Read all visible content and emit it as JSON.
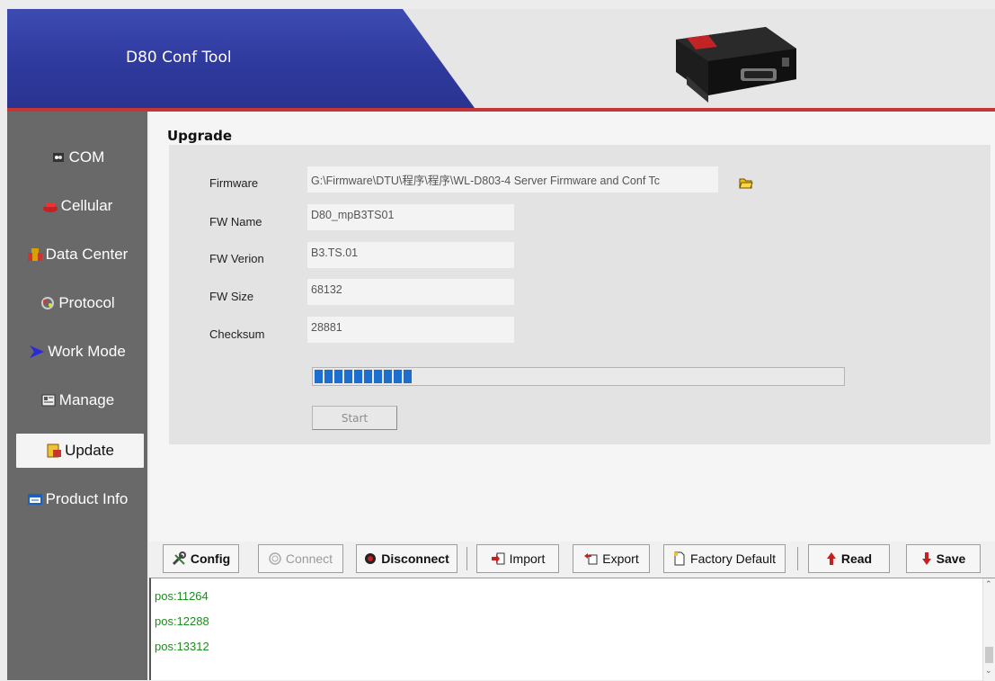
{
  "header": {
    "title": "D80 Conf Tool",
    "device_image": "d80-device-photo"
  },
  "sidebar": {
    "items": [
      {
        "label": "COM",
        "icon": "com-port-icon"
      },
      {
        "label": "Cellular",
        "icon": "phone-icon"
      },
      {
        "label": "Data Center",
        "icon": "server-icon"
      },
      {
        "label": "Protocol",
        "icon": "protocol-icon"
      },
      {
        "label": "Work Mode",
        "icon": "arrow-icon"
      },
      {
        "label": "Manage",
        "icon": "manage-icon"
      },
      {
        "label": "Update",
        "icon": "update-icon",
        "selected": true
      },
      {
        "label": "Product Info",
        "icon": "info-icon"
      }
    ]
  },
  "upgrade": {
    "title": "Upgrade",
    "firmware_label": "Firmware",
    "firmware_value": "G:\\Firmware\\DTU\\程序\\程序\\WL-D803-4 Server Firmware and Conf Tc",
    "fw_name_label": "FW Name",
    "fw_name_value": "D80_mpB3TS01",
    "fw_version_label": "FW Verion",
    "fw_version_value": "B3.TS.01",
    "fw_size_label": "FW Size",
    "fw_size_value": "68132",
    "checksum_label": "Checksum",
    "checksum_value": "28881",
    "progress_fraction": 0.19,
    "start_label": "Start"
  },
  "toolbar": {
    "config": "Config",
    "connect": "Connect",
    "disconnect": "Disconnect",
    "import": "Import",
    "export": "Export",
    "factory_default": "Factory Default",
    "read": "Read",
    "save": "Save"
  },
  "log": {
    "lines": [
      "pos:11264",
      "pos:12288",
      "pos:13312"
    ]
  },
  "colors": {
    "header_blue": "#2f3a9e",
    "accent_red": "#c43535",
    "sidebar_bg": "#696969",
    "log_text": "#1e8c1e",
    "progress": "#1d6fcf"
  }
}
